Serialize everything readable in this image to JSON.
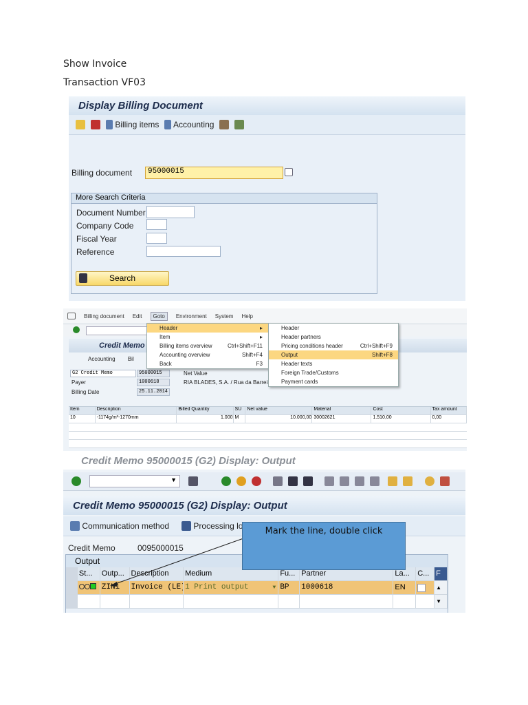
{
  "doc": {
    "heading1": "Show Invoice",
    "heading2": "Transaction VF03"
  },
  "screen1": {
    "title": "Display Billing Document",
    "toolbar": {
      "billing_items": "Billing items",
      "accounting": "Accounting"
    },
    "billing_document_label": "Billing document",
    "billing_document_value": "95000015",
    "group_title": "More Search Criteria",
    "fields": [
      {
        "label": "Document Number",
        "value": ""
      },
      {
        "label": "Company Code",
        "value": ""
      },
      {
        "label": "Fiscal Year",
        "value": ""
      },
      {
        "label": "Reference",
        "value": ""
      }
    ],
    "search_button": "Search"
  },
  "screen2": {
    "menubar": [
      "Billing document",
      "Edit",
      "Goto",
      "Environment",
      "System",
      "Help"
    ],
    "goto_menu": [
      {
        "label": "Header",
        "shortcut": ""
      },
      {
        "label": "Item",
        "shortcut": ""
      },
      {
        "label": "Billing items overview",
        "shortcut": "Ctrl+Shift+F11"
      },
      {
        "label": "Accounting overview",
        "shortcut": "Shift+F4"
      },
      {
        "label": "Back",
        "shortcut": "F3"
      }
    ],
    "header_submenu": [
      {
        "label": "Header",
        "shortcut": ""
      },
      {
        "label": "Header partners",
        "shortcut": ""
      },
      {
        "label": "Pricing conditions header",
        "shortcut": "Ctrl+Shift+F9"
      },
      {
        "label": "Output",
        "shortcut": "Shift+F8"
      },
      {
        "label": "Header texts",
        "shortcut": ""
      },
      {
        "label": "Foreign Trade/Customs",
        "shortcut": ""
      },
      {
        "label": "Payment cards",
        "shortcut": ""
      }
    ],
    "title": "Credit Memo",
    "accounting": "Accounting",
    "billing": "Bil",
    "doc_type": "G2 Credit Memo",
    "doc_number": "95000015",
    "net_value_label": "Net Value",
    "payer_label": "Payer",
    "payer": "1000618",
    "payer_name": "RIA BLADES, S.A. / Rua da Barrei",
    "billing_date_label": "Billing Date",
    "billing_date": "25.11.2014",
    "columns": [
      "Item",
      "Description",
      "Billed Quantity",
      "SU",
      "Net value",
      "Material",
      "Cost",
      "Tax amount"
    ],
    "rows": [
      [
        "10",
        "-1174g/m²-1270mm",
        "1.000",
        "M",
        "10.000,00",
        "30002621",
        "1.510,00",
        "0,00"
      ]
    ]
  },
  "screen3": {
    "window_title": "Credit Memo 95000015  (G2) Display: Output",
    "title": "Credit Memo 95000015  (G2) Display: Output",
    "communication_method": "Communication method",
    "processing_log": "Processing log",
    "credit_memo_label": "Credit Memo",
    "credit_memo_value": "0095000015",
    "group_title": "Output",
    "columns": [
      "St...",
      "Outp...",
      "Description",
      "Medium",
      "Fu...",
      "Partner",
      "La...",
      "C...",
      "F"
    ],
    "rows": [
      {
        "output": "ZIN1",
        "description": "Invoice (LE)",
        "medium": "1 Print output",
        "function": "BP",
        "partner": "1000618",
        "language": "EN"
      }
    ],
    "callout": "Mark the  line, double click"
  }
}
